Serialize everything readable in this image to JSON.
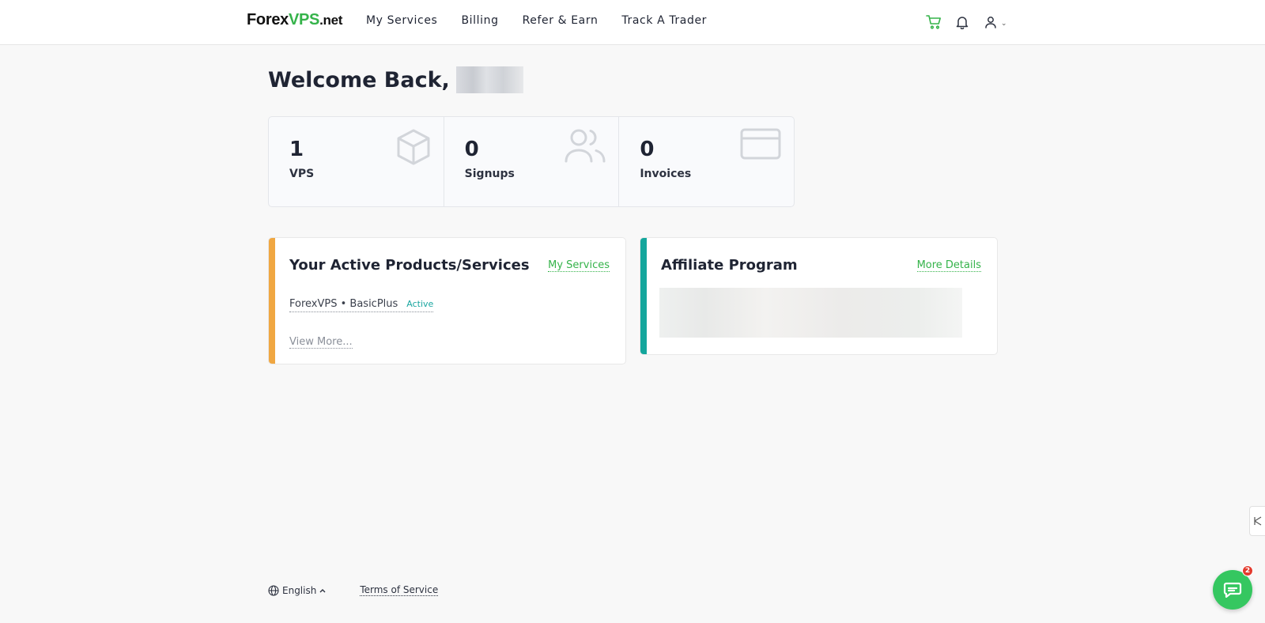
{
  "header": {
    "logo": {
      "part1": "Forex",
      "part2": "VPS",
      "part3": ".net"
    },
    "nav": [
      "My Services",
      "Billing",
      "Refer & Earn",
      "Track A Trader"
    ],
    "icons": [
      "cart-icon",
      "bell-icon",
      "user-icon",
      "chevron-down-icon"
    ]
  },
  "welcome": {
    "text": "Welcome Back,"
  },
  "stats": [
    {
      "value": "1",
      "label": "VPS",
      "icon": "box-icon"
    },
    {
      "value": "0",
      "label": "Signups",
      "icon": "users-icon"
    },
    {
      "value": "0",
      "label": "Invoices",
      "icon": "credit-card-icon"
    }
  ],
  "products_card": {
    "title": "Your Active Products/Services",
    "link": "My Services",
    "product_name": "ForexVPS • BasicPlus",
    "product_status": "Active",
    "view_more": "View More...",
    "accent_color": "#f0a742"
  },
  "affiliate_card": {
    "title": "Affiliate Program",
    "link": "More Details",
    "accent_color": "#14a69c"
  },
  "footer": {
    "language": "English",
    "terms": "Terms of Service"
  },
  "chat": {
    "badge_count": "2"
  },
  "colors": {
    "brand_green": "#35b34a",
    "status_teal": "#1aa6a0"
  }
}
